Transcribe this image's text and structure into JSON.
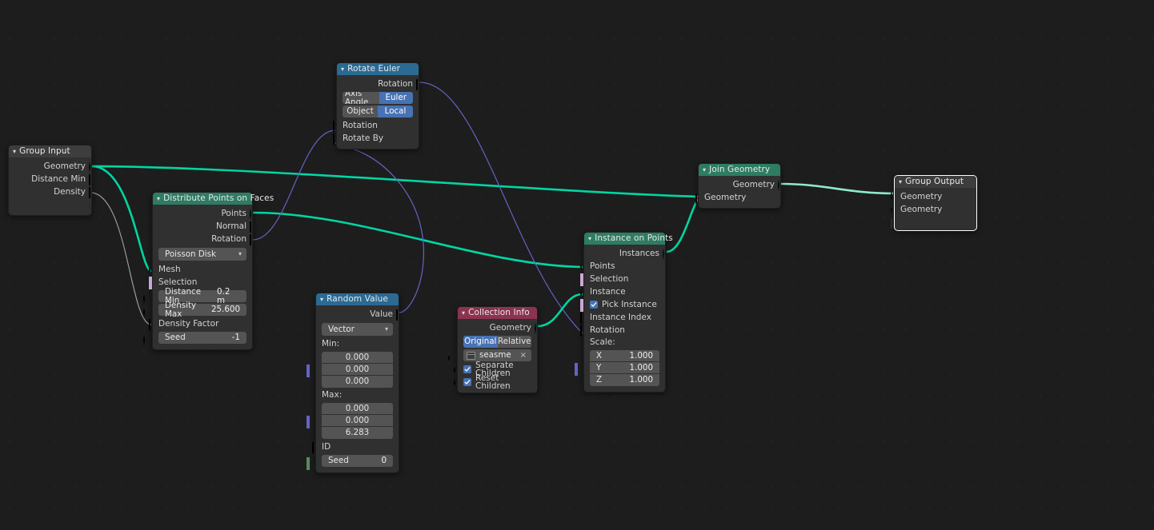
{
  "app": {
    "editor": "Blender Geometry Node Editor"
  },
  "colors": {
    "background": "#1d1d1d",
    "node_body": "#303030",
    "header_geometry": "#2e7c63",
    "header_vector": "#2a6a93",
    "header_input": "#8c3350",
    "header_group": "#3d3d3d",
    "socket_geometry": "#00d6a3",
    "socket_vector": "#6363c7",
    "socket_boolean": "#cca6d6",
    "socket_float": "#9a9a9a",
    "socket_integer": "#598c5c",
    "toggle_active": "#4772b3",
    "link_geometry": "#00d6a3",
    "link_vector": "#6363c7",
    "link_float": "#9a9a9a",
    "selection_outline": "#ffffff"
  },
  "nodes": {
    "group_input": {
      "title": "Group Input",
      "outputs": [
        {
          "label": "Geometry",
          "type": "geometry"
        },
        {
          "label": "Distance Min",
          "type": "float"
        },
        {
          "label": "Density",
          "type": "float"
        },
        {
          "label": "",
          "type": "virtual"
        }
      ]
    },
    "distribute_points": {
      "title": "Distribute Points on Faces",
      "outputs": [
        {
          "label": "Points",
          "type": "geometry"
        },
        {
          "label": "Normal",
          "type": "vector"
        },
        {
          "label": "Rotation",
          "type": "vector"
        }
      ],
      "method": "Poisson Disk",
      "inputs": [
        {
          "label": "Mesh",
          "type": "geometry"
        },
        {
          "label": "Selection",
          "type": "boolean"
        }
      ],
      "fields": [
        {
          "label": "Distance Min",
          "value": "0.2 m",
          "type": "float"
        },
        {
          "label": "Density Max",
          "value": "25.600",
          "type": "float"
        }
      ],
      "density_factor": {
        "label": "Density Factor",
        "type": "float"
      },
      "seed": {
        "label": "Seed",
        "value": "-1",
        "type": "integer"
      }
    },
    "rotate_euler": {
      "title": "Rotate Euler",
      "output": {
        "label": "Rotation",
        "type": "vector"
      },
      "type_toggle": {
        "options": [
          "Axis Angle",
          "Euler"
        ],
        "active": "Euler"
      },
      "space_toggle": {
        "options": [
          "Object",
          "Local"
        ],
        "active": "Local"
      },
      "inputs": [
        {
          "label": "Rotation",
          "type": "vector"
        },
        {
          "label": "Rotate By",
          "type": "vector"
        }
      ]
    },
    "random_value": {
      "title": "Random Value",
      "output": {
        "label": "Value",
        "type": "vector"
      },
      "data_type": "Vector",
      "min_label": "Min:",
      "min_values": [
        "0.000",
        "0.000",
        "0.000"
      ],
      "max_label": "Max:",
      "max_values": [
        "0.000",
        "0.000",
        "6.283"
      ],
      "id": {
        "label": "ID",
        "type": "integer"
      },
      "seed": {
        "label": "Seed",
        "value": "0",
        "type": "integer"
      }
    },
    "collection_info": {
      "title": "Collection Info",
      "output": {
        "label": "Geometry",
        "type": "geometry"
      },
      "transform_toggle": {
        "options": [
          "Original",
          "Relative"
        ],
        "active": "Original"
      },
      "collection": {
        "name": "seasme",
        "clear": "×"
      },
      "separate_children": {
        "label": "Separate Children",
        "checked": true
      },
      "reset_children": {
        "label": "Reset Children",
        "checked": true
      }
    },
    "instance_on_points": {
      "title": "Instance on Points",
      "output": {
        "label": "Instances",
        "type": "geometry"
      },
      "inputs": [
        {
          "label": "Points",
          "type": "geometry"
        },
        {
          "label": "Selection",
          "type": "boolean"
        },
        {
          "label": "Instance",
          "type": "geometry"
        }
      ],
      "pick_instance": {
        "label": "Pick Instance",
        "checked": true
      },
      "instance_index": {
        "label": "Instance Index",
        "type": "integer"
      },
      "rotation": {
        "label": "Rotation",
        "type": "vector"
      },
      "scale_label": "Scale:",
      "scale": [
        {
          "axis": "X",
          "value": "1.000"
        },
        {
          "axis": "Y",
          "value": "1.000"
        },
        {
          "axis": "Z",
          "value": "1.000"
        }
      ]
    },
    "join_geometry": {
      "title": "Join Geometry",
      "output": {
        "label": "Geometry",
        "type": "geometry"
      },
      "input": {
        "label": "Geometry",
        "type": "geometry-multi"
      }
    },
    "group_output": {
      "title": "Group Output",
      "selected": true,
      "inputs": [
        {
          "label": "Geometry",
          "type": "geometry"
        },
        {
          "label": "Geometry",
          "type": "geometry"
        },
        {
          "label": "",
          "type": "virtual"
        }
      ]
    }
  }
}
